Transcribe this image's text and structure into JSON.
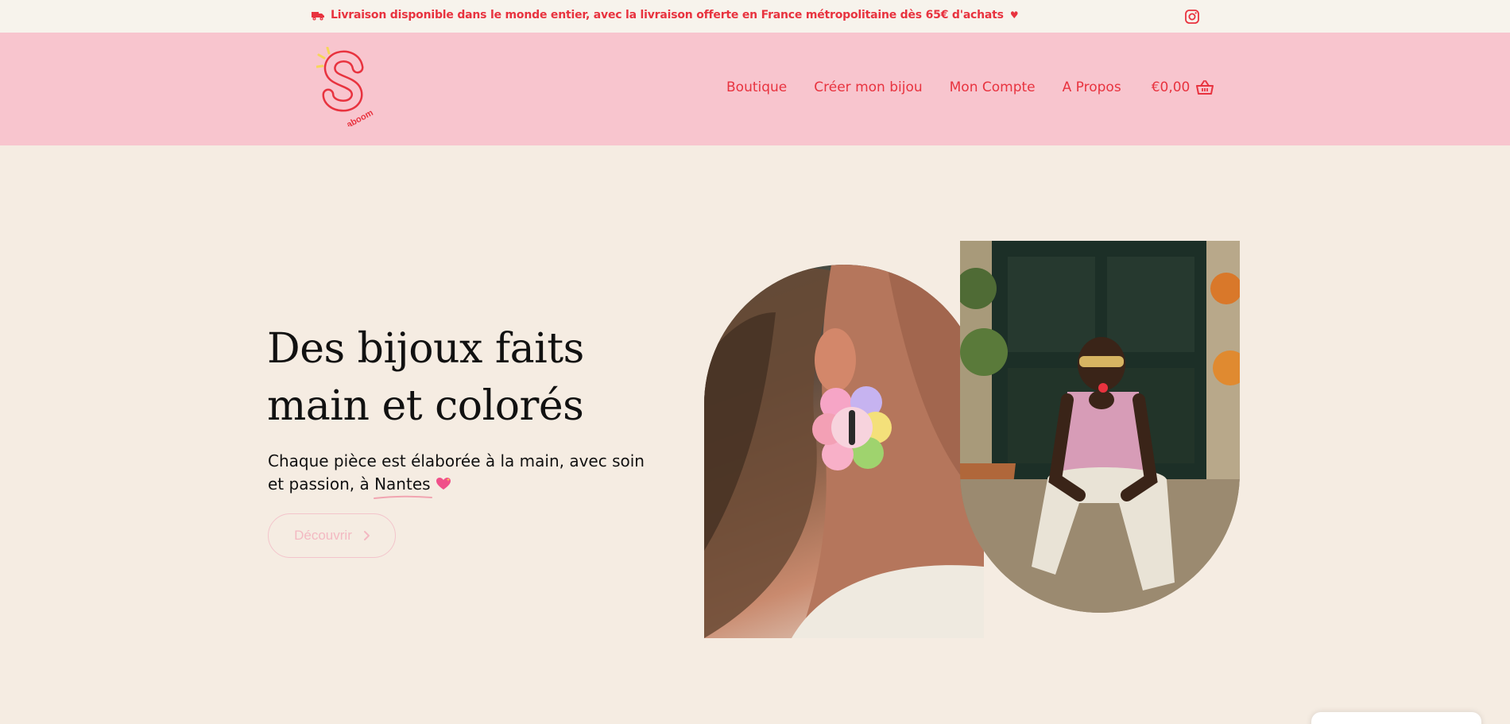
{
  "topbar": {
    "message": "Livraison disponible dans le monde entier, avec la livraison offerte en France métropolitaine dès 65€ d'achats",
    "heart": "♥",
    "icons": [
      "truck-icon",
      "instagram-icon"
    ]
  },
  "header": {
    "logo_text": "aboom",
    "nav": [
      {
        "label": "Boutique"
      },
      {
        "label": "Créer mon bijou"
      },
      {
        "label": "Mon Compte"
      },
      {
        "label": "A Propos"
      }
    ],
    "cart_total": "€0,00"
  },
  "hero": {
    "title_line1": "Des bijoux faits",
    "title_line2": "main et colorés",
    "subtitle_part1": "Chaque pièce est élaborée à la main, avec soin et passion, à ",
    "subtitle_city": "Nantes",
    "cta_label": "Découvrir"
  },
  "colors": {
    "accent": "#e8333f",
    "header_bg": "#f8c5ce",
    "page_bg": "#f5ece2",
    "topbar_bg": "#f7f3ec",
    "cta": "#f3b9c2"
  }
}
